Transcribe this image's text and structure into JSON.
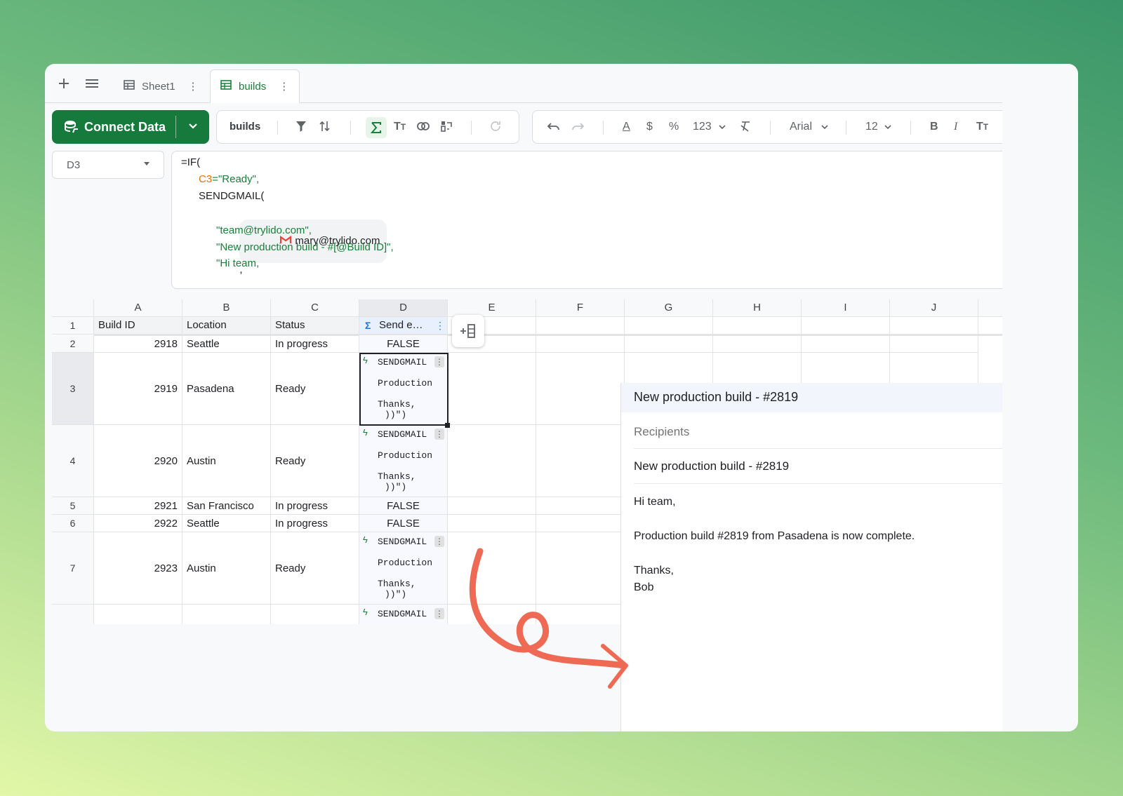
{
  "tabbar": {
    "tabs": [
      {
        "label": "Sheet1",
        "active": false
      },
      {
        "label": "builds",
        "active": true
      }
    ]
  },
  "toolbar": {
    "connect_label": "Connect Data",
    "sheet_name": "builds",
    "format_number": "123",
    "font": "Arial",
    "font_size": "12"
  },
  "formula_bar": {
    "cell_ref": "D3",
    "lines": {
      "l1": "=IF(",
      "l2_ref": "C3",
      "l2_rest": "=\"Ready\",",
      "l3": "SENDGMAIL(",
      "chip_email": "mary@trylido.com",
      "chip_comma": ",",
      "l5": "\"team@trylido.com\",",
      "l6": "\"New production build - #[@Build ID]\",",
      "l7": "\"Hi team,"
    }
  },
  "sheet": {
    "columns": [
      "A",
      "B",
      "C",
      "D",
      "E",
      "F",
      "G",
      "H",
      "I",
      "J"
    ],
    "headers": [
      "Build ID",
      "Location",
      "Status",
      "Send e…"
    ],
    "rows": [
      {
        "n": "1"
      },
      {
        "n": "2",
        "id": "2918",
        "loc": "Seattle",
        "status": "In progress",
        "d": "FALSE"
      },
      {
        "n": "3",
        "id": "2919",
        "loc": "Pasadena",
        "status": "Ready",
        "d1": "SENDGMAIL",
        "d2": "Production",
        "d3": "Thanks,",
        "d4": "))\")"
      },
      {
        "n": "4",
        "id": "2920",
        "loc": "Austin",
        "status": "Ready",
        "d1": "SENDGMAIL",
        "d2": "Production",
        "d3": "Thanks,",
        "d4": "))\")"
      },
      {
        "n": "5",
        "id": "2921",
        "loc": "San Francisco",
        "status": "In progress",
        "d": "FALSE"
      },
      {
        "n": "6",
        "id": "2922",
        "loc": "Seattle",
        "status": "In progress",
        "d": "FALSE"
      },
      {
        "n": "7",
        "id": "2923",
        "loc": "Austin",
        "status": "Ready",
        "d1": "SENDGMAIL",
        "d2": "Production",
        "d3": "Thanks,",
        "d4": "))\")"
      },
      {
        "n": "",
        "d1": "SENDGMAIL"
      }
    ]
  },
  "email": {
    "header_subject": "New production build - #2819",
    "recipients_label": "Recipients",
    "subject": "New production build - #2819",
    "greeting": "Hi team,",
    "body": "Production build #2819 from Pasadena is now complete.",
    "signoff": "Thanks,",
    "signature": "Bob"
  },
  "colors": {
    "brand_green": "#157a3b",
    "accent_green": "#188038",
    "arrow": "#ee6a55"
  }
}
